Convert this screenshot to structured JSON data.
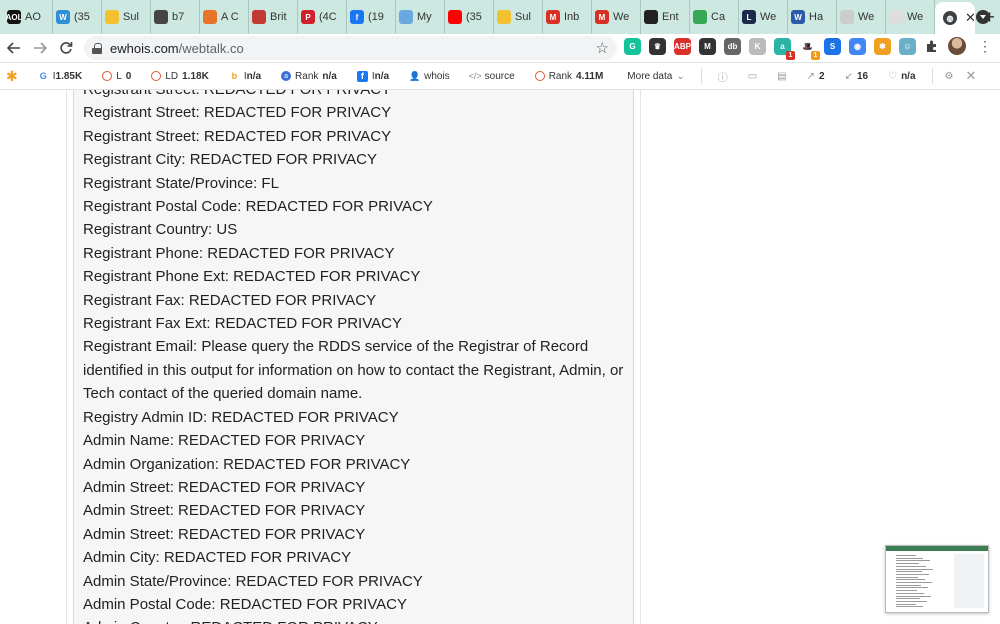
{
  "tabs": [
    {
      "label": "AO",
      "fav": "AOL",
      "color": "#111111"
    },
    {
      "label": "(35",
      "fav": "W",
      "color": "#2d8fd5"
    },
    {
      "label": "Sul",
      "fav": "",
      "color": "#f2c230"
    },
    {
      "label": "b7",
      "fav": "",
      "color": "#444444"
    },
    {
      "label": "A C",
      "fav": "",
      "color": "#e8732a"
    },
    {
      "label": "Brit",
      "fav": "",
      "color": "#c23b32"
    },
    {
      "label": "(4C",
      "fav": "P",
      "color": "#d0202b"
    },
    {
      "label": "(19",
      "fav": "f",
      "color": "#1877f2"
    },
    {
      "label": "My",
      "fav": "",
      "color": "#6aa8e0"
    },
    {
      "label": "(35",
      "fav": "",
      "color": "#ff0000"
    },
    {
      "label": "Sul",
      "fav": "",
      "color": "#f2c230"
    },
    {
      "label": "Inb",
      "fav": "M",
      "color": "#d93025"
    },
    {
      "label": "We",
      "fav": "M",
      "color": "#d93025"
    },
    {
      "label": "Ent",
      "fav": "",
      "color": "#222222"
    },
    {
      "label": "Ca",
      "fav": "",
      "color": "#34a853"
    },
    {
      "label": "We",
      "fav": "L",
      "color": "#1b2a4a"
    },
    {
      "label": "Ha",
      "fav": "W",
      "color": "#2b5aa8"
    },
    {
      "label": "We",
      "fav": "",
      "color": "#cccccc"
    },
    {
      "label": "We",
      "fav": "",
      "color": "#dddddd"
    }
  ],
  "active_tab": {
    "close": "✕"
  },
  "new_tab": "+",
  "omnibox": {
    "domain": "ewhois.com",
    "path": "/webtalk.co"
  },
  "icons": {
    "back": "back-arrow-icon",
    "forward": "forward-arrow-icon",
    "reload": "reload-icon",
    "lock": "lock-icon",
    "star": "star-icon",
    "puzzle": "extensions-icon"
  },
  "extensions": [
    {
      "name": "grammarly-icon",
      "text": "G",
      "color": "#15c39a",
      "badge": ""
    },
    {
      "name": "extension-crown-icon",
      "text": "♛",
      "color": "#333333",
      "badge": ""
    },
    {
      "name": "adblock-plus-icon",
      "text": "ABP",
      "color": "#d9302c",
      "badge": ""
    },
    {
      "name": "medium-icon",
      "text": "M",
      "color": "#333333",
      "badge": ""
    },
    {
      "name": "extension-db-icon",
      "text": "db",
      "color": "#666666",
      "badge": ""
    },
    {
      "name": "extension-k-icon",
      "text": "K",
      "color": "#bbbbbb",
      "badge": ""
    },
    {
      "name": "extension-a-icon",
      "text": "a",
      "color": "#2bb3a3",
      "badge": "1",
      "badge_color": "#d93025"
    },
    {
      "name": "extension-hat-icon",
      "text": "🎩",
      "color": "#ffffff",
      "badge": "1",
      "badge_color": "#f09a1a"
    },
    {
      "name": "extension-s-icon",
      "text": "S",
      "color": "#1a73e8",
      "badge": ""
    },
    {
      "name": "extension-circle-icon",
      "text": "◉",
      "color": "#4285f4",
      "badge": ""
    },
    {
      "name": "seoquake-icon",
      "text": "✱",
      "color": "#f0a020",
      "badge": ""
    },
    {
      "name": "extension-face-icon",
      "text": "☺",
      "color": "#6ab0c8",
      "badge": ""
    }
  ],
  "seobar": {
    "google_index": "1.85K",
    "l_label": "L",
    "l_value": "0",
    "ld_label": "LD",
    "ld_value": "1.18K",
    "bing_value": "n/a",
    "rank_label": "Rank",
    "rank_value": "n/a",
    "fb_value": "n/a",
    "whois": "whois",
    "source": "source",
    "rank2_label": "Rank",
    "rank2_value": "4.11M",
    "more_data": "More data",
    "links_out": "2",
    "links_in": "16",
    "heart_value": "n/a"
  },
  "whois_lines": [
    "Registrant Street: REDACTED FOR PRIVACY",
    "Registrant Street: REDACTED FOR PRIVACY",
    "Registrant Street: REDACTED FOR PRIVACY",
    "Registrant City: REDACTED FOR PRIVACY",
    "Registrant State/Province: FL",
    "Registrant Postal Code: REDACTED FOR PRIVACY",
    "Registrant Country: US",
    "Registrant Phone: REDACTED FOR PRIVACY",
    "Registrant Phone Ext: REDACTED FOR PRIVACY",
    "Registrant Fax: REDACTED FOR PRIVACY",
    "Registrant Fax Ext: REDACTED FOR PRIVACY",
    "Registrant Email: Please query the RDDS service of the Registrar of Record identified in this output for information on how to contact the Registrant, Admin, or Tech contact of the queried domain name.",
    "Registry Admin ID: REDACTED FOR PRIVACY",
    "Admin Name: REDACTED FOR PRIVACY",
    "Admin Organization: REDACTED FOR PRIVACY",
    "Admin Street: REDACTED FOR PRIVACY",
    "Admin Street: REDACTED FOR PRIVACY",
    "Admin Street: REDACTED FOR PRIVACY",
    "Admin City: REDACTED FOR PRIVACY",
    "Admin State/Province: REDACTED FOR PRIVACY",
    "Admin Postal Code: REDACTED FOR PRIVACY",
    "Admin Country: REDACTED FOR PRIVACY"
  ]
}
